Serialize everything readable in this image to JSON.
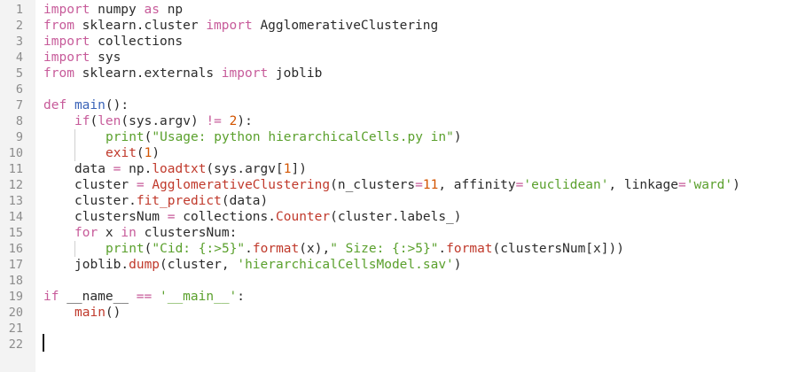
{
  "editor": {
    "colors": {
      "keyword": "#c75b9a",
      "plain": "#2b2b2b",
      "builtin": "#3a63b8",
      "call": "#c0392b",
      "string": "#5aa02c",
      "number": "#d35400",
      "gutter_bg": "#f3f3f3",
      "line_number": "#8c8c8c"
    },
    "lines": [
      {
        "n": "1",
        "indent": 0,
        "tokens": [
          [
            "import",
            "keyword"
          ],
          [
            " numpy ",
            "plain"
          ],
          [
            "as",
            "keyword"
          ],
          [
            " np",
            "plain"
          ]
        ]
      },
      {
        "n": "2",
        "indent": 0,
        "tokens": [
          [
            "from",
            "keyword"
          ],
          [
            " sklearn.cluster ",
            "plain"
          ],
          [
            "import",
            "keyword"
          ],
          [
            " AgglomerativeClustering",
            "plain"
          ]
        ]
      },
      {
        "n": "3",
        "indent": 0,
        "tokens": [
          [
            "import",
            "keyword"
          ],
          [
            " collections",
            "plain"
          ]
        ]
      },
      {
        "n": "4",
        "indent": 0,
        "tokens": [
          [
            "import",
            "keyword"
          ],
          [
            " sys",
            "plain"
          ]
        ]
      },
      {
        "n": "5",
        "indent": 0,
        "tokens": [
          [
            "from",
            "keyword"
          ],
          [
            " sklearn.externals ",
            "plain"
          ],
          [
            "import",
            "keyword"
          ],
          [
            " joblib",
            "plain"
          ]
        ]
      },
      {
        "n": "6",
        "indent": 0,
        "tokens": []
      },
      {
        "n": "7",
        "indent": 0,
        "tokens": [
          [
            "def",
            "keyword"
          ],
          [
            " ",
            "plain"
          ],
          [
            "main",
            "builtin"
          ],
          [
            "():",
            "plain"
          ]
        ]
      },
      {
        "n": "8",
        "indent": 1,
        "tokens": [
          [
            "if",
            "keyword"
          ],
          [
            "(",
            "plain"
          ],
          [
            "len",
            "keyword"
          ],
          [
            "(sys.argv) ",
            "plain"
          ],
          [
            "!=",
            "keyword"
          ],
          [
            " ",
            "plain"
          ],
          [
            "2",
            "number"
          ],
          [
            "):",
            "plain"
          ]
        ]
      },
      {
        "n": "9",
        "indent": 2,
        "tokens": [
          [
            "print",
            "string"
          ],
          [
            "(",
            "plain"
          ],
          [
            "\"Usage: python hierarchicalCells.py in\"",
            "string"
          ],
          [
            ")",
            "plain"
          ]
        ]
      },
      {
        "n": "10",
        "indent": 2,
        "tokens": [
          [
            "exit",
            "call"
          ],
          [
            "(",
            "plain"
          ],
          [
            "1",
            "number"
          ],
          [
            ")",
            "plain"
          ]
        ]
      },
      {
        "n": "11",
        "indent": 1,
        "tokens": [
          [
            "data ",
            "plain"
          ],
          [
            "=",
            "keyword"
          ],
          [
            " np.",
            "plain"
          ],
          [
            "loadtxt",
            "call"
          ],
          [
            "(sys.argv[",
            "plain"
          ],
          [
            "1",
            "number"
          ],
          [
            "])",
            "plain"
          ]
        ]
      },
      {
        "n": "12",
        "indent": 1,
        "tokens": [
          [
            "cluster ",
            "plain"
          ],
          [
            "=",
            "keyword"
          ],
          [
            " ",
            "plain"
          ],
          [
            "AgglomerativeClustering",
            "call"
          ],
          [
            "(n_clusters",
            "plain"
          ],
          [
            "=",
            "keyword"
          ],
          [
            "11",
            "number"
          ],
          [
            ", affinity",
            "plain"
          ],
          [
            "=",
            "keyword"
          ],
          [
            "'euclidean'",
            "string"
          ],
          [
            ", linkage",
            "plain"
          ],
          [
            "=",
            "keyword"
          ],
          [
            "'ward'",
            "string"
          ],
          [
            ")",
            "plain"
          ]
        ]
      },
      {
        "n": "13",
        "indent": 1,
        "tokens": [
          [
            "cluster.",
            "plain"
          ],
          [
            "fit_predict",
            "call"
          ],
          [
            "(data)",
            "plain"
          ]
        ]
      },
      {
        "n": "14",
        "indent": 1,
        "tokens": [
          [
            "clustersNum ",
            "plain"
          ],
          [
            "=",
            "keyword"
          ],
          [
            " collections.",
            "plain"
          ],
          [
            "Counter",
            "call"
          ],
          [
            "(cluster.labels_)",
            "plain"
          ]
        ]
      },
      {
        "n": "15",
        "indent": 1,
        "tokens": [
          [
            "for",
            "keyword"
          ],
          [
            " x ",
            "plain"
          ],
          [
            "in",
            "keyword"
          ],
          [
            " clustersNum:",
            "plain"
          ]
        ]
      },
      {
        "n": "16",
        "indent": 2,
        "tokens": [
          [
            "print",
            "string"
          ],
          [
            "(",
            "plain"
          ],
          [
            "\"Cid: {:>5}\"",
            "string"
          ],
          [
            ".",
            "plain"
          ],
          [
            "format",
            "call"
          ],
          [
            "(x),",
            "plain"
          ],
          [
            "\" Size: {:>5}\"",
            "string"
          ],
          [
            ".",
            "plain"
          ],
          [
            "format",
            "call"
          ],
          [
            "(clustersNum[x]))",
            "plain"
          ]
        ]
      },
      {
        "n": "17",
        "indent": 1,
        "tokens": [
          [
            "joblib.",
            "plain"
          ],
          [
            "dump",
            "call"
          ],
          [
            "(cluster, ",
            "plain"
          ],
          [
            "'hierarchicalCellsModel.sav'",
            "string"
          ],
          [
            ")",
            "plain"
          ]
        ]
      },
      {
        "n": "18",
        "indent": 0,
        "tokens": []
      },
      {
        "n": "19",
        "indent": 0,
        "tokens": [
          [
            "if",
            "keyword"
          ],
          [
            " __name__ ",
            "plain"
          ],
          [
            "==",
            "keyword"
          ],
          [
            " ",
            "plain"
          ],
          [
            "'__main__'",
            "string"
          ],
          [
            ":",
            "plain"
          ]
        ]
      },
      {
        "n": "20",
        "indent": 1,
        "tokens": [
          [
            "main",
            "call"
          ],
          [
            "()",
            "plain"
          ]
        ]
      },
      {
        "n": "21",
        "indent": 0,
        "tokens": []
      },
      {
        "n": "22",
        "indent": 0,
        "tokens": []
      }
    ]
  }
}
